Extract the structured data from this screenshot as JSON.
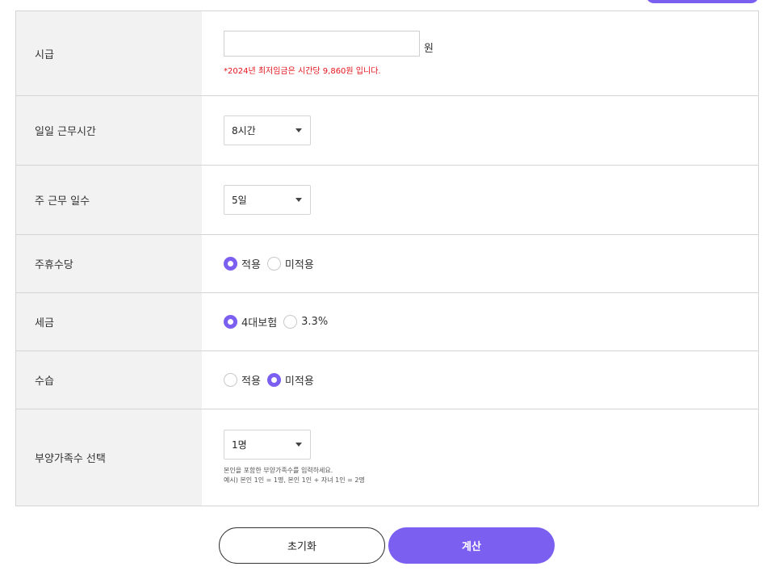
{
  "accent_color": "#7b5ff0",
  "note_color": "#e3141b",
  "hourly_wage": {
    "label": "시급",
    "value": "",
    "unit": "원",
    "note": "*2024년 최저임금은 시간당 9,860원 입니다."
  },
  "daily_hours": {
    "label": "일일 근무시간",
    "selected": "8시간"
  },
  "weekly_days": {
    "label": "주 근무 일수",
    "selected": "5일"
  },
  "weekly_holiday_pay": {
    "label": "주휴수당",
    "options": [
      {
        "label": "적용",
        "checked": true
      },
      {
        "label": "미적용",
        "checked": false
      }
    ]
  },
  "tax": {
    "label": "세금",
    "options": [
      {
        "label": "4대보험",
        "checked": true
      },
      {
        "label": "3.3%",
        "checked": false
      }
    ]
  },
  "probation": {
    "label": "수습",
    "options": [
      {
        "label": "적용",
        "checked": false
      },
      {
        "label": "미적용",
        "checked": true
      }
    ]
  },
  "dependents": {
    "label": "부양가족수 선택",
    "selected": "1명",
    "help_line1": "본인을 포함한 부양가족수를 입력하세요.",
    "help_line2": "예시) 본인 1인 = 1명, 본인 1인 + 자녀 1인 = 2명"
  },
  "buttons": {
    "reset": "초기화",
    "calculate": "계산"
  }
}
